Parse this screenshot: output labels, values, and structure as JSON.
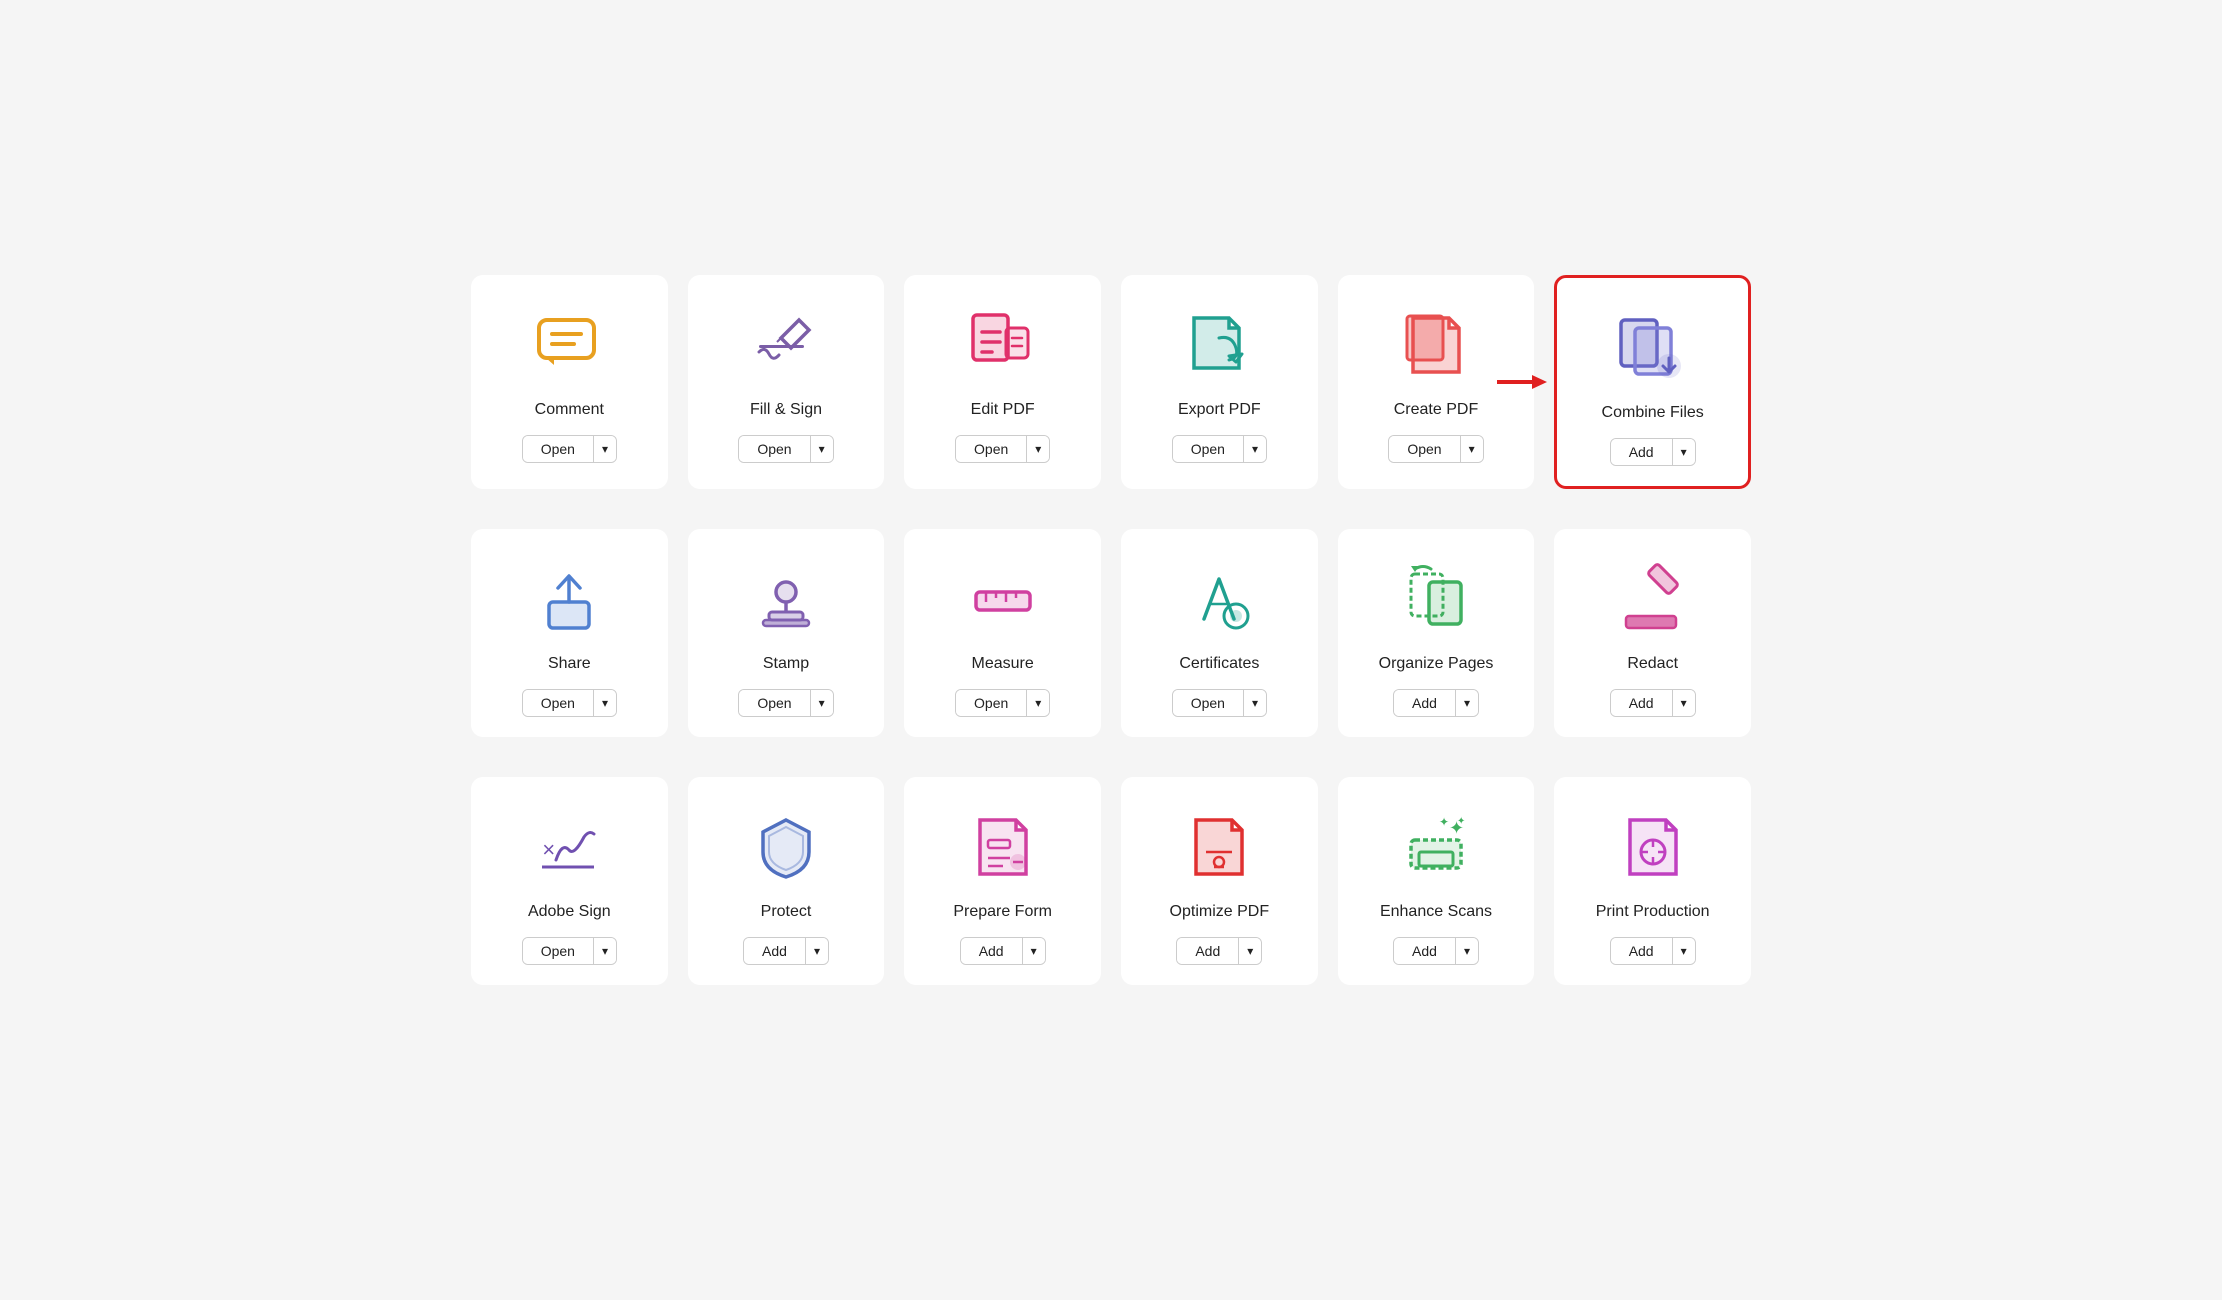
{
  "rows": [
    {
      "items": [
        {
          "id": "comment",
          "label": "Comment",
          "btn": "Open",
          "highlighted": false,
          "iconColor": "#e8a020"
        },
        {
          "id": "fill-sign",
          "label": "Fill & Sign",
          "btn": "Open",
          "highlighted": false,
          "iconColor": "#7b5ea7"
        },
        {
          "id": "edit-pdf",
          "label": "Edit PDF",
          "btn": "Open",
          "highlighted": false,
          "iconColor": "#e0306a"
        },
        {
          "id": "export-pdf",
          "label": "Export PDF",
          "btn": "Open",
          "highlighted": false,
          "iconColor": "#20a090"
        },
        {
          "id": "create-pdf",
          "label": "Create PDF",
          "btn": "Open",
          "highlighted": false,
          "iconColor": "#e85050"
        },
        {
          "id": "combine-files",
          "label": "Combine Files",
          "btn": "Add",
          "highlighted": true,
          "iconColor": "#6060c0"
        }
      ]
    },
    {
      "items": [
        {
          "id": "share",
          "label": "Share",
          "btn": "Open",
          "highlighted": false,
          "iconColor": "#5080d0"
        },
        {
          "id": "stamp",
          "label": "Stamp",
          "btn": "Open",
          "highlighted": false,
          "iconColor": "#8060b0"
        },
        {
          "id": "measure",
          "label": "Measure",
          "btn": "Open",
          "highlighted": false,
          "iconColor": "#d040a0"
        },
        {
          "id": "certificates",
          "label": "Certificates",
          "btn": "Open",
          "highlighted": false,
          "iconColor": "#20a090"
        },
        {
          "id": "organize-pages",
          "label": "Organize Pages",
          "btn": "Add",
          "highlighted": false,
          "iconColor": "#40b060"
        },
        {
          "id": "redact",
          "label": "Redact",
          "btn": "Add",
          "highlighted": false,
          "iconColor": "#d04090"
        }
      ]
    },
    {
      "items": [
        {
          "id": "adobe-sign",
          "label": "Adobe Sign",
          "btn": "Open",
          "highlighted": false,
          "iconColor": "#7050b0"
        },
        {
          "id": "protect",
          "label": "Protect",
          "btn": "Add",
          "highlighted": false,
          "iconColor": "#5070c0"
        },
        {
          "id": "prepare-form",
          "label": "Prepare Form",
          "btn": "Add",
          "highlighted": false,
          "iconColor": "#d040a0"
        },
        {
          "id": "optimize-pdf",
          "label": "Optimize PDF",
          "btn": "Add",
          "highlighted": false,
          "iconColor": "#e03030"
        },
        {
          "id": "enhance-scans",
          "label": "Enhance Scans",
          "btn": "Add",
          "highlighted": false,
          "iconColor": "#40b060"
        },
        {
          "id": "print-production",
          "label": "Print Production",
          "btn": "Add",
          "highlighted": false,
          "iconColor": "#c040c0"
        }
      ]
    }
  ]
}
